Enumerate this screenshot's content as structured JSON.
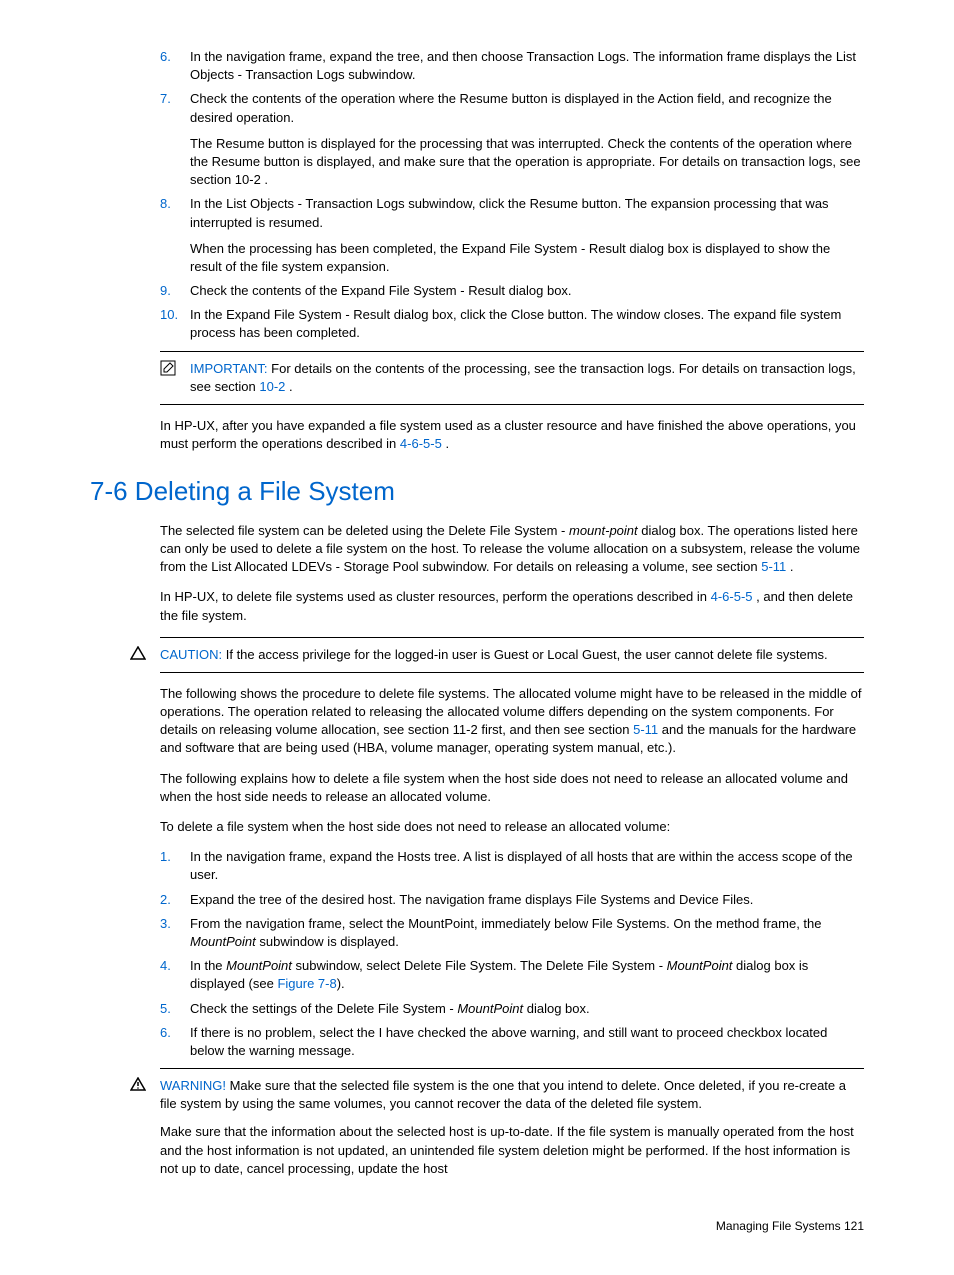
{
  "list1": [
    {
      "num": "6.",
      "paras": [
        "In the navigation frame, expand the tree, and then choose Transaction Logs. The information frame displays the List Objects - Transaction Logs subwindow."
      ]
    },
    {
      "num": "7.",
      "paras": [
        "Check the contents of the operation where the Resume button is displayed in the Action field, and recognize the desired operation.",
        "The Resume button is displayed for the processing that was interrupted. Check the contents of the operation where the Resume button is displayed, and make sure that the operation is appropriate. For details on transaction logs, see section 10-2 ."
      ]
    },
    {
      "num": "8.",
      "paras": [
        "In the List Objects - Transaction Logs subwindow, click the Resume button. The expansion processing that was interrupted is resumed.",
        "When the processing has been completed, the Expand File System - Result dialog box is displayed to show the result of the file system expansion."
      ]
    },
    {
      "num": "9.",
      "paras": [
        "Check the contents of the Expand File System - Result dialog box."
      ]
    },
    {
      "num": "10.",
      "paras": [
        "In the Expand File System - Result dialog box, click the Close button. The window closes. The expand file system process has been completed."
      ]
    }
  ],
  "important1": {
    "label": "IMPORTANT:",
    "text_before": "  For details on the contents of the processing, see the transaction logs. For details on transaction logs, see section ",
    "link": "10-2",
    "text_after": " ."
  },
  "para_hpux1": {
    "before": "In HP-UX, after you have expanded a file system used as a cluster resource and have finished the above operations, you must perform the operations described in ",
    "link": "4-6-5-5",
    "after": " ."
  },
  "heading": "7-6 Deleting a File System",
  "para_sel": {
    "before": "The selected file system can be deleted using the Delete File System - ",
    "italic": "mount-point",
    "mid": " dialog box. The operations listed here can only be used to delete a file system on the host. To release the volume allocation on a subsystem, release the volume from the List Allocated LDEVs - Storage Pool subwindow. For details on releasing a volume, see section ",
    "link": "5-11",
    "after": " ."
  },
  "para_hpux2": {
    "before": "In HP-UX, to delete file systems used as cluster resources, perform the operations described in ",
    "link": "4-6-5-5",
    "after": " , and then delete the file system."
  },
  "caution1": {
    "label": "CAUTION:",
    "text": "  If the access privilege for the logged-in user is Guest or Local Guest, the user cannot delete file systems."
  },
  "para_proc": {
    "before": "The following shows the procedure to delete file systems. The allocated volume might have to be released in the middle of operations. The operation related to releasing the allocated volume differs depending on the system components. For details on releasing volume allocation, see section 11-2  first, and then see section ",
    "link": "5-11",
    "after": "  and the manuals for the hardware and software that are being used (HBA, volume manager, operating system manual, etc.)."
  },
  "para_explain": "The following explains how to delete a file system when the host side does not need to release an allocated volume and when the host side needs to release an allocated volume.",
  "para_todelete": "To delete a file system when the host side does not need to release an allocated volume:",
  "list2": {
    "i1": {
      "num": "1.",
      "text": "In the navigation frame, expand the Hosts tree. A list is displayed of all hosts that are within the access scope of the user."
    },
    "i2": {
      "num": "2.",
      "text": "Expand the tree of the desired host. The navigation frame displays File Systems and Device Files."
    },
    "i3": {
      "num": "3.",
      "before": "From the navigation frame, select the MountPoint, immediately below File Systems. On the method frame, the ",
      "italic": "MountPoint",
      "after": " subwindow is displayed."
    },
    "i4": {
      "num": "4.",
      "b1": "In the ",
      "it1": "MountPoint",
      "b2": " subwindow, select Delete File System. The Delete File System - ",
      "it2": "MountPoint",
      "b3": " dialog box is displayed (see ",
      "link": "Figure 7-8",
      "b4": ")."
    },
    "i5": {
      "num": "5.",
      "before": "Check the settings of the Delete File System - ",
      "italic": "MountPoint",
      "after": " dialog box."
    },
    "i6": {
      "num": "6.",
      "text": "If there is no problem, select the I have checked the above warning, and still want to proceed checkbox located below the warning message."
    }
  },
  "warning1": {
    "label": "WARNING!",
    "p1": "  Make sure that the selected file system is the one that you intend to delete. Once deleted, if you re-create a file system by using the same volumes, you cannot recover the data of the deleted file system.",
    "p2": "Make sure that the information about the selected host is up-to-date. If the file system is manually operated from the host and the host information is not updated, an unintended file system deletion might be performed. If the host information is not up to date, cancel processing, update the host"
  },
  "footer": "Managing File Systems  121"
}
